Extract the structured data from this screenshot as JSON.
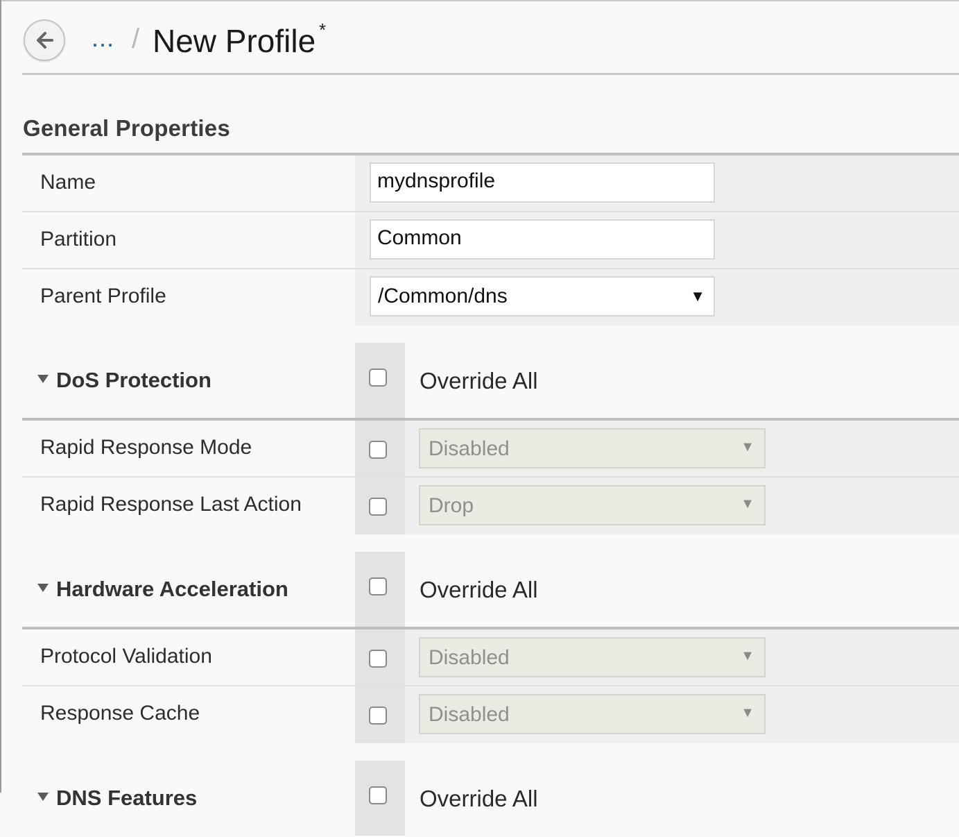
{
  "header": {
    "breadcrumb_ellipsis": "...",
    "breadcrumb_separator": "/",
    "title": "New Profile",
    "unsaved_marker": "*"
  },
  "general_properties": {
    "section_title": "General Properties",
    "name": {
      "label": "Name",
      "value": "mydnsprofile"
    },
    "partition": {
      "label": "Partition",
      "value": "Common"
    },
    "parent_profile": {
      "label": "Parent Profile",
      "value": "/Common/dns"
    }
  },
  "dos_protection": {
    "title": "DoS Protection",
    "override_all_label": "Override All",
    "override_all_checked": false,
    "rapid_response_mode": {
      "label": "Rapid Response Mode",
      "value": "Disabled",
      "checked": false
    },
    "rapid_response_last_action": {
      "label": "Rapid Response Last Action",
      "value": "Drop",
      "checked": false
    }
  },
  "hardware_acceleration": {
    "title": "Hardware Acceleration",
    "override_all_label": "Override All",
    "override_all_checked": false,
    "protocol_validation": {
      "label": "Protocol Validation",
      "value": "Disabled",
      "checked": false
    },
    "response_cache": {
      "label": "Response Cache",
      "value": "Disabled",
      "checked": false
    }
  },
  "dns_features": {
    "title": "DNS Features",
    "override_all_label": "Override All",
    "override_all_checked": false
  },
  "colors": {
    "link_blue": "#1f5f99",
    "disabled_select_bg": "#ebeae3",
    "rule_gray": "#c0c0c0"
  },
  "icons": {
    "back": "arrow-left-circle-icon",
    "collapse": "triangle-down-icon",
    "dropdown": "caret-down-icon"
  }
}
